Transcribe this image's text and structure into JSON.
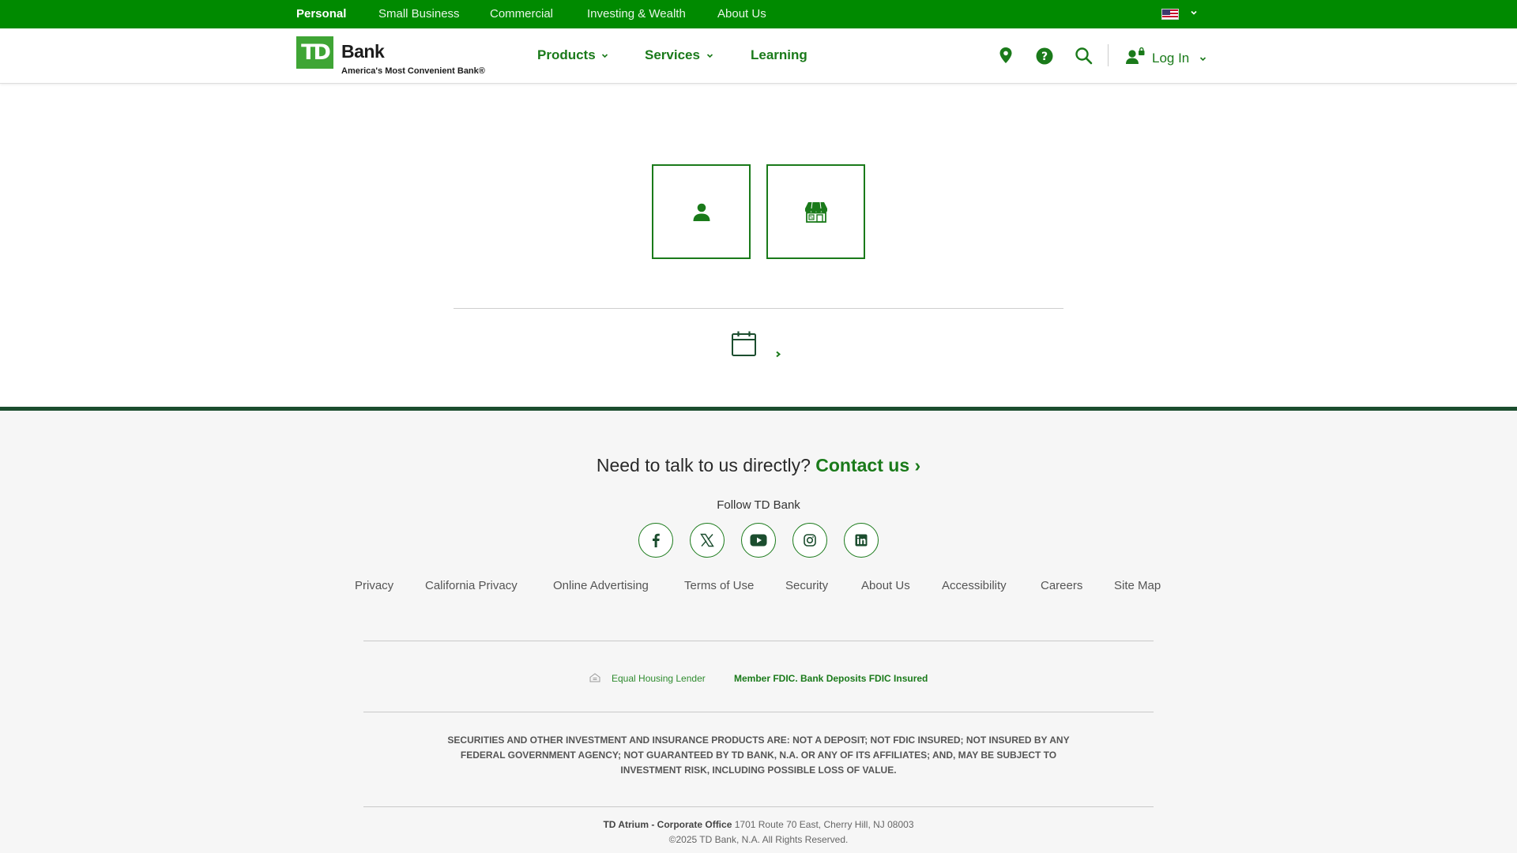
{
  "topbar": {
    "segments": [
      "Personal",
      "Small Business",
      "Commercial",
      "Investing & Wealth",
      "About Us"
    ],
    "active": "Personal",
    "country_icon": "us-flag-icon"
  },
  "header": {
    "logo_mark": "TD",
    "logo_name": "Bank",
    "logo_tagline": "America's Most Convenient Bank®",
    "nav": [
      "Products",
      "Services",
      "Learning"
    ],
    "icons": [
      "location-pin-icon",
      "help-icon",
      "search-icon",
      "user-lock-icon"
    ],
    "login_label": "Log In"
  },
  "content": {
    "tiles": [
      "person-icon",
      "storefront-icon"
    ],
    "calendar_icon": "calendar-icon"
  },
  "footer": {
    "talk_prefix": "Need to talk to us directly?",
    "contact_label": "Contact us ›",
    "follow_label": "Follow TD Bank",
    "social": [
      "facebook-icon",
      "x-icon",
      "youtube-icon",
      "instagram-icon",
      "linkedin-icon"
    ],
    "links": [
      "Privacy",
      "California Privacy",
      "Online Advertising",
      "Terms of Use",
      "Security",
      "About Us",
      "Accessibility",
      "Careers",
      "Site Map"
    ],
    "equal_housing": "Equal Housing Lender",
    "fdic": "Member FDIC. Bank Deposits FDIC Insured",
    "disclaimer": "SECURITIES AND OTHER INVESTMENT AND INSURANCE PRODUCTS ARE: NOT A DEPOSIT; NOT FDIC INSURED; NOT INSURED BY ANY FEDERAL GOVERNMENT AGENCY; NOT GUARANTEED BY TD BANK, N.A. OR ANY OF ITS AFFILIATES; AND, MAY BE SUBJECT TO INVESTMENT RISK, INCLUDING POSSIBLE LOSS OF VALUE.",
    "office_label": "TD Atrium - Corporate Office",
    "office_address": "1701 Route 70 East, Cherry Hill, NJ 08003",
    "copyright": "©2025 TD Bank, N.A. All Rights Reserved."
  },
  "colors": {
    "brand_green": "#008a00",
    "link_green": "#1a7a1a",
    "logo_green": "#3fa535",
    "footer_border": "#1b4d2e"
  }
}
